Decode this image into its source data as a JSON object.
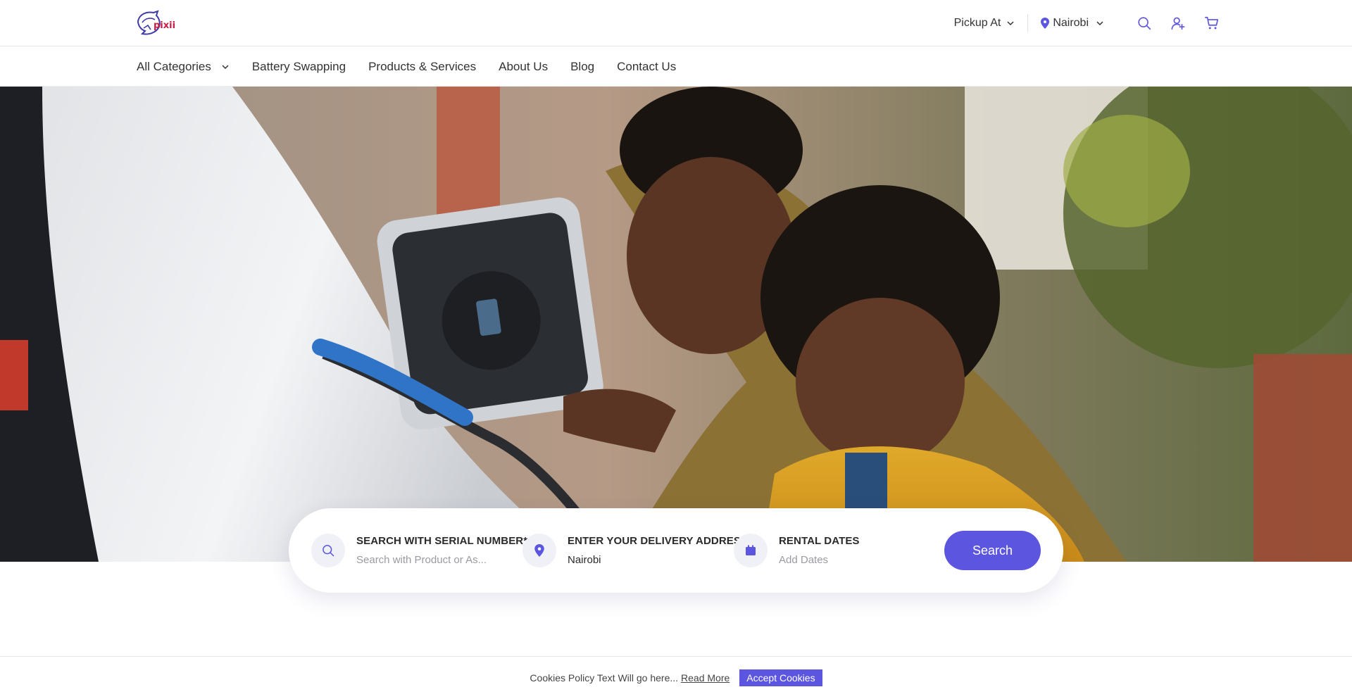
{
  "brand": {
    "logo_text": "pixii"
  },
  "header": {
    "pickup_label": "Pickup At",
    "city_label": "Nairobi",
    "icons": [
      "search-icon",
      "user-add-icon",
      "cart-icon"
    ]
  },
  "nav": {
    "items": [
      "All Categories",
      "Battery Swapping",
      "Products & Services",
      "About Us",
      "Blog",
      "Contact Us"
    ]
  },
  "search": {
    "serial_label": "SEARCH WITH SERIAL NUMBER*",
    "serial_placeholder": "Search with Product or As...",
    "address_label": "ENTER YOUR DELIVERY ADDRESS..*",
    "address_value": "Nairobi",
    "dates_label": "RENTAL DATES",
    "dates_placeholder": "Add Dates",
    "button_label": "Search"
  },
  "cookie": {
    "text": "Cookies Policy Text Will go here...",
    "read_more": "Read More",
    "accept": "Accept Cookies"
  },
  "colors": {
    "accent": "#5b55e0",
    "logo_red": "#c81d45",
    "logo_blue": "#3f3aa8"
  }
}
